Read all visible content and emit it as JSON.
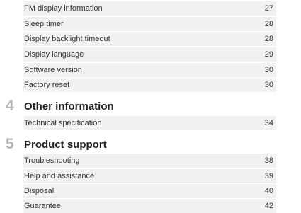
{
  "entries_top": [
    {
      "label": "FM display information",
      "page": "27"
    },
    {
      "label": "Sleep timer",
      "page": "28"
    },
    {
      "label": "Display backlight timeout",
      "page": "28"
    },
    {
      "label": "Display language",
      "page": "29"
    },
    {
      "label": "Software version",
      "page": "30"
    },
    {
      "label": "Factory reset",
      "page": "30"
    }
  ],
  "section_4": {
    "number": "4",
    "title": "Other information",
    "entries": [
      {
        "label": "Technical specification",
        "page": "34"
      }
    ]
  },
  "section_5": {
    "number": "5",
    "title": "Product support",
    "entries": [
      {
        "label": "Troubleshooting",
        "page": "38"
      },
      {
        "label": "Help and assistance",
        "page": "39"
      },
      {
        "label": "Disposal",
        "page": "40"
      },
      {
        "label": "Guarantee",
        "page": "42"
      }
    ]
  }
}
